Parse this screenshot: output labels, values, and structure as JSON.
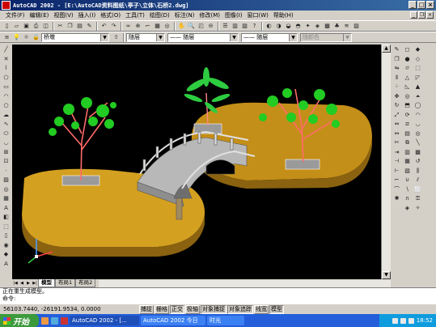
{
  "window": {
    "title": "AutoCAD 2002 - [E:\\AutoCAD资料图纸\\亭子\\立体\\石桥2.dwg]",
    "buttons": [
      "_",
      "□",
      "×"
    ]
  },
  "menubar": {
    "items": [
      "文件(F)",
      "编辑(E)",
      "视图(V)",
      "插入(I)",
      "格式(O)",
      "工具(T)",
      "绘图(D)",
      "标注(N)",
      "修改(M)",
      "图像(I)",
      "窗口(W)",
      "帮助(H)"
    ]
  },
  "layer_toolbar": {
    "layer_value": "桥墩",
    "color_value": "随层",
    "linetype_value": "—— 随层",
    "lineweight_value": "—— 随层",
    "plotstyle_value": "随颜色"
  },
  "layout_tabs": {
    "nav": [
      "|◀",
      "◀",
      "▶",
      "▶|"
    ],
    "tabs": [
      "模型",
      "布局1",
      "布局2"
    ],
    "active_index": 0
  },
  "command": {
    "history_line": "正在重生成模型。",
    "prompt": "命令:"
  },
  "statusbar": {
    "coordinates": "56103.7440, -26191.9534, 0.0000",
    "toggles": [
      "捕捉",
      "栅格",
      "正交",
      "极轴",
      "对象捕捉",
      "对象追踪",
      "线宽",
      "模型"
    ],
    "toggles_on": [
      false,
      false,
      true,
      false,
      true,
      true,
      false,
      true
    ]
  },
  "taskbar": {
    "start_label": "开始",
    "items": [
      "AutoCAD 2002 - [...",
      "AutoCAD 2002 今日",
      "时光"
    ],
    "active_index": 0,
    "clock": "18:52"
  },
  "colors": {
    "title_bar": "#0a246a",
    "viewport_bg": "#000000",
    "ground": "#d4a020",
    "bridge": "#b8b8b8",
    "foliage": "#22cc22",
    "branches": "#ff6666",
    "taskbar": "#245edb",
    "start_button": "#3c9a3c"
  }
}
